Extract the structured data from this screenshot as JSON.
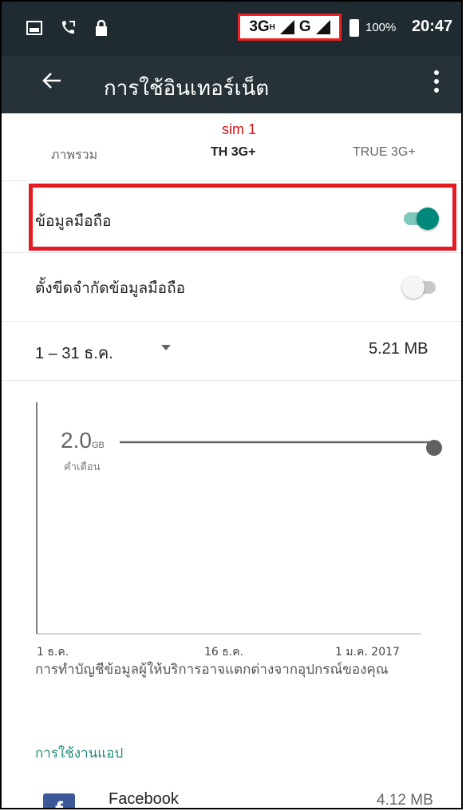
{
  "status_bar": {
    "network_1": "3G",
    "network_sup": "H",
    "network_2": "G",
    "battery": "100%",
    "time": "20:47"
  },
  "app_bar": {
    "title": "การใช้อินเทอร์เน็ต"
  },
  "tabs": {
    "overview": "ภาพรวม",
    "sim_label": "sim 1",
    "sim1": "TH 3G+",
    "sim2": "TRUE 3G+"
  },
  "settings": {
    "mobile_data_label": "ข้อมูลมือถือ",
    "mobile_data_on": true,
    "limit_label": "ตั้งขีดจำกัดข้อมูลมือถือ",
    "limit_on": false
  },
  "period": {
    "range": "1 – 31 ธ.ค.",
    "usage": "5.21 MB"
  },
  "chart_data": {
    "type": "line",
    "x_ticks": [
      "1 ธ.ค.",
      "16 ธ.ค.",
      "1 ม.ค. 2017"
    ],
    "warning_value": "2.0",
    "warning_unit": "GB",
    "warning_label": "คำเตือน"
  },
  "footer": {
    "note": "การทำบัญชีข้อมูลผู้ให้บริการอาจแตกต่างจากอุปกรณ์ของคุณ",
    "section_title": "การใช้งานแอป"
  },
  "apps": [
    {
      "name": "Facebook",
      "size": "4.12 MB",
      "icon": "facebook-icon"
    }
  ],
  "colors": {
    "accent": "#00897b",
    "highlight_red": "#e41b23",
    "appbar": "#263238"
  }
}
